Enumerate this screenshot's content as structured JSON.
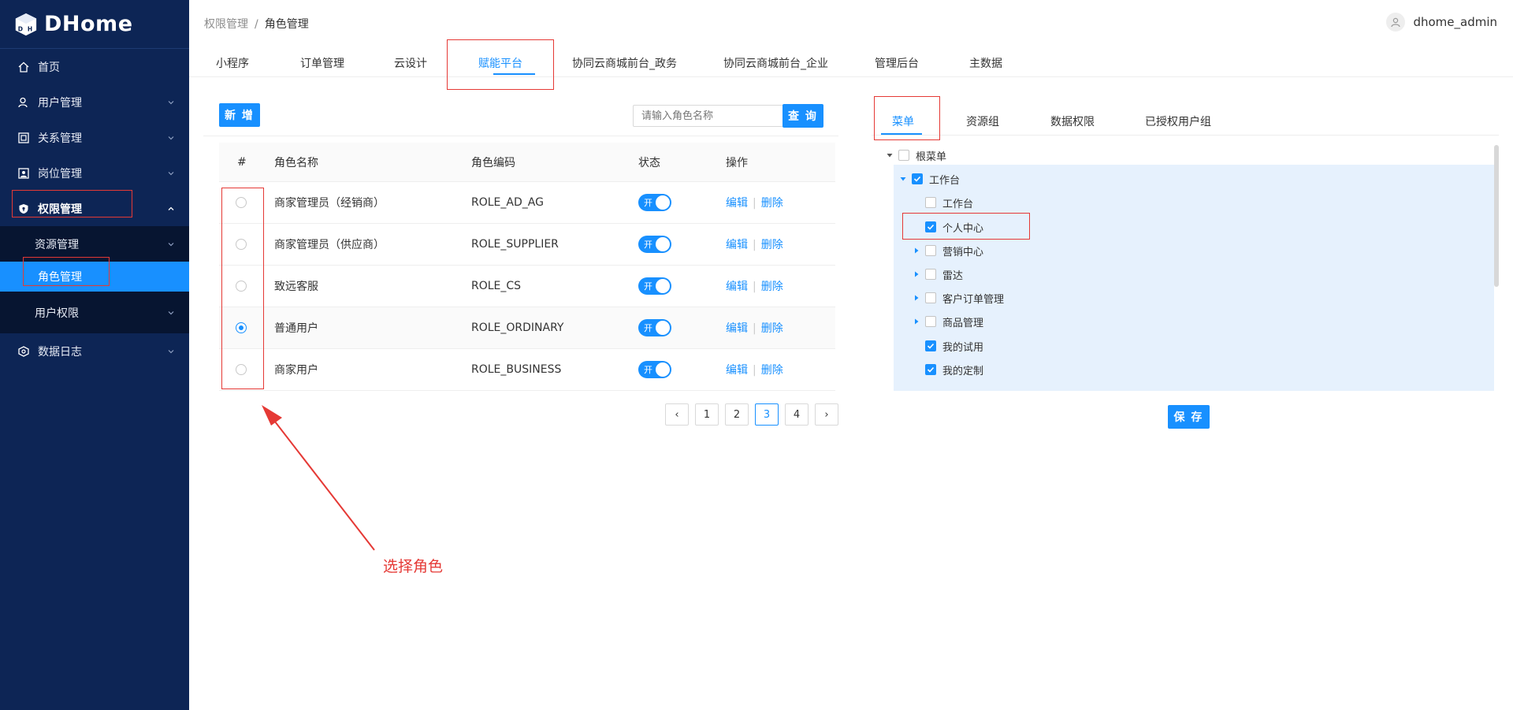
{
  "app": {
    "brand": "DHome"
  },
  "sidebar": {
    "items": [
      {
        "label": "首页",
        "icon": "home-icon"
      },
      {
        "label": "用户管理",
        "icon": "user-icon"
      },
      {
        "label": "关系管理",
        "icon": "relation-icon"
      },
      {
        "label": "岗位管理",
        "icon": "post-icon"
      },
      {
        "label": "权限管理",
        "icon": "shield-icon"
      },
      {
        "label": "数据日志",
        "icon": "log-icon"
      }
    ],
    "submenu": [
      {
        "label": "资源管理"
      },
      {
        "label": "角色管理"
      },
      {
        "label": "用户权限"
      }
    ]
  },
  "header": {
    "breadcrumb": [
      "权限管理",
      "角色管理"
    ],
    "breadcrumb_sep": "/",
    "username": "dhome_admin"
  },
  "app_tabs": [
    "小程序",
    "订单管理",
    "云设计",
    "赋能平台",
    "协同云商城前台_政务",
    "协同云商城前台_企业",
    "管理后台",
    "主数据"
  ],
  "app_tabs_active": "赋能平台",
  "toolbar": {
    "add_label": "新 增",
    "search_placeholder": "请输入角色名称",
    "search_label": "查 询"
  },
  "table": {
    "columns": [
      "#",
      "角色名称",
      "角色编码",
      "状态",
      "操作"
    ],
    "rows": [
      {
        "name": "商家管理员（经销商）",
        "code": "ROLE_AD_AG",
        "status": "开",
        "selected": false
      },
      {
        "name": "商家管理员（供应商）",
        "code": "ROLE_SUPPLIER",
        "status": "开",
        "selected": false
      },
      {
        "name": "致远客服",
        "code": "ROLE_CS",
        "status": "开",
        "selected": false
      },
      {
        "name": "普通用户",
        "code": "ROLE_ORDINARY",
        "status": "开",
        "selected": true
      },
      {
        "name": "商家用户",
        "code": "ROLE_BUSINESS",
        "status": "开",
        "selected": false
      }
    ],
    "edit_label": "编辑",
    "delete_label": "删除"
  },
  "pagination": {
    "pages": [
      "1",
      "2",
      "3",
      "4"
    ],
    "current": "3",
    "prev": "‹",
    "next": "›"
  },
  "right_panel": {
    "tabs": [
      "菜单",
      "资源组",
      "数据权限",
      "已授权用户组"
    ],
    "active_tab": "菜单",
    "tree": [
      {
        "label": "根菜单",
        "level": 0,
        "caret": "down",
        "checked": false
      },
      {
        "label": "工作台",
        "level": 1,
        "caret": "down",
        "checked": true
      },
      {
        "label": "工作台",
        "level": 2,
        "caret": "none",
        "checked": false
      },
      {
        "label": "个人中心",
        "level": 2,
        "caret": "none",
        "checked": true
      },
      {
        "label": "营销中心",
        "level": 2,
        "caret": "right",
        "checked": false
      },
      {
        "label": "雷达",
        "level": 2,
        "caret": "right",
        "checked": false
      },
      {
        "label": "客户订单管理",
        "level": 2,
        "caret": "right",
        "checked": false
      },
      {
        "label": "商品管理",
        "level": 2,
        "caret": "right",
        "checked": false
      },
      {
        "label": "我的试用",
        "level": 2,
        "caret": "none",
        "checked": true
      },
      {
        "label": "我的定制",
        "level": 2,
        "caret": "none",
        "checked": true
      }
    ],
    "save_label": "保 存"
  },
  "annotation": {
    "text": "选择角色",
    "color": "#e53935"
  },
  "colors": {
    "sidebar_bg": "#0d2555",
    "primary": "#1890ff",
    "annotation": "#e53935"
  }
}
